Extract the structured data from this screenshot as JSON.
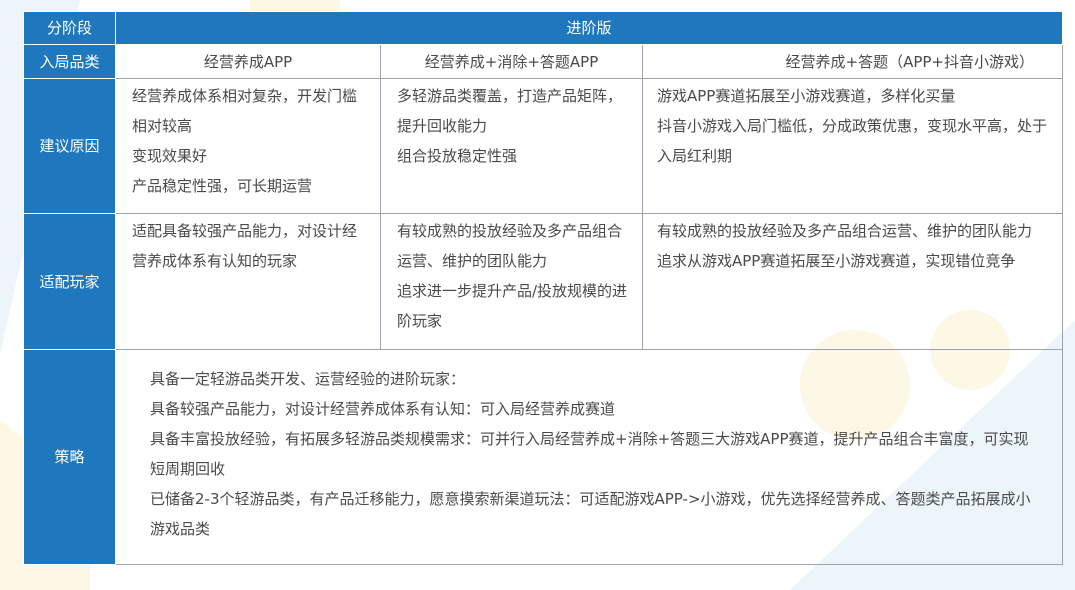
{
  "table": {
    "header": {
      "stage_label": "分阶段",
      "stage_value": "进阶版"
    },
    "category_row": {
      "label": "入局品类",
      "columns": [
        "经营养成APP",
        "经营养成+消除+答题APP",
        "经营养成+答题（APP+抖音小游戏）"
      ]
    },
    "reason_row": {
      "label": "建议原因",
      "columns": [
        [
          "经营养成体系相对复杂，开发门槛相对较高",
          "变现效果好",
          "产品稳定性强，可长期运营"
        ],
        [
          "多轻游品类覆盖，打造产品矩阵，提升回收能力",
          "组合投放稳定性强"
        ],
        [
          "游戏APP赛道拓展至小游戏赛道，多样化买量",
          "抖音小游戏入局门槛低，分成政策优惠，变现水平高，处于入局红利期"
        ]
      ]
    },
    "player_row": {
      "label": "适配玩家",
      "columns": [
        [
          "适配具备较强产品能力，对设计经营养成体系有认知的玩家"
        ],
        [
          "有较成熟的投放经验及多产品组合运营、维护的团队能力",
          "追求进一步提升产品/投放规模的进阶玩家"
        ],
        [
          "有较成熟的投放经验及多产品组合运营、维护的团队能力",
          "追求从游戏APP赛道拓展至小游戏赛道，实现错位竞争"
        ]
      ]
    },
    "strategy_row": {
      "label": "策略",
      "lines": [
        "具备一定轻游品类开发、运营经验的进阶玩家：",
        "具备较强产品能力，对设计经营养成体系有认知：可入局经营养成赛道",
        "具备丰富投放经验，有拓展多轻游品类规模需求：可并行入局经营养成+消除+答题三大游戏APP赛道，提升产品组合丰富度，可实现短周期回收",
        "已储备2-3个轻游品类，有产品迁移能力，愿意摸索新渠道玩法：可适配游戏APP->小游戏，优先选择经营养成、答题类产品拓展成小游戏品类"
      ]
    }
  },
  "colors": {
    "header_blue": "#1f78bd",
    "border_gray": "#9ba3ad",
    "text_gray": "#4a4a4a",
    "decor_yellow": "#fbf3cf",
    "decor_blue": "#dfeff7"
  }
}
